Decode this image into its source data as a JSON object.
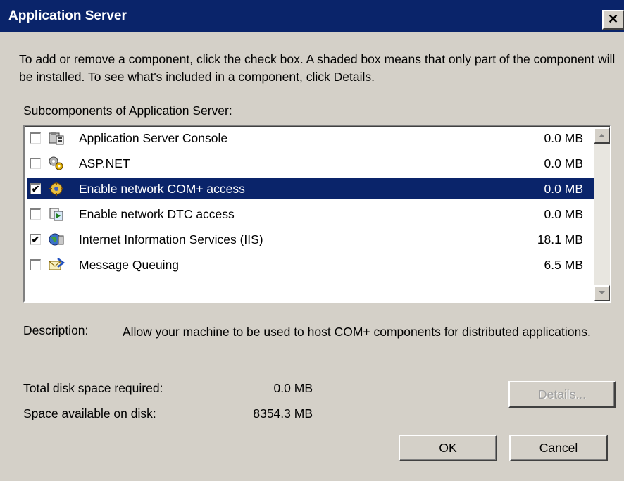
{
  "window": {
    "title": "Application Server",
    "close_glyph": "✕"
  },
  "instructions": "To add or remove a component, click the check box. A shaded box means that only part of the component will be installed. To see what's included in a component, click Details.",
  "subcomponents_label": "Subcomponents of Application Server:",
  "components": [
    {
      "name": "Application Server Console",
      "size": "0.0 MB",
      "checked": false,
      "selected": false,
      "icon": "server-console-icon"
    },
    {
      "name": "ASP.NET",
      "size": "0.0 MB",
      "checked": false,
      "selected": false,
      "icon": "aspnet-gear-icon"
    },
    {
      "name": "Enable network COM+ access",
      "size": "0.0 MB",
      "checked": true,
      "selected": true,
      "icon": "com-plus-icon"
    },
    {
      "name": "Enable network DTC access",
      "size": "0.0 MB",
      "checked": false,
      "selected": false,
      "icon": "dtc-icon"
    },
    {
      "name": "Internet Information Services (IIS)",
      "size": "18.1 MB",
      "checked": true,
      "selected": false,
      "icon": "iis-globe-icon"
    },
    {
      "name": "Message Queuing",
      "size": "6.5 MB",
      "checked": false,
      "selected": false,
      "icon": "message-queue-icon"
    }
  ],
  "description": {
    "label": "Description:",
    "text": "Allow your machine to be used to host COM+ components for distributed applications."
  },
  "disk": {
    "required_label": "Total disk space required:",
    "required_value": "0.0 MB",
    "available_label": "Space available on disk:",
    "available_value": "8354.3 MB"
  },
  "buttons": {
    "details": "Details...",
    "ok": "OK",
    "cancel": "Cancel"
  },
  "colors": {
    "titlebar": "#0a246a",
    "face": "#d4d0c8",
    "selection": "#0a246a"
  }
}
